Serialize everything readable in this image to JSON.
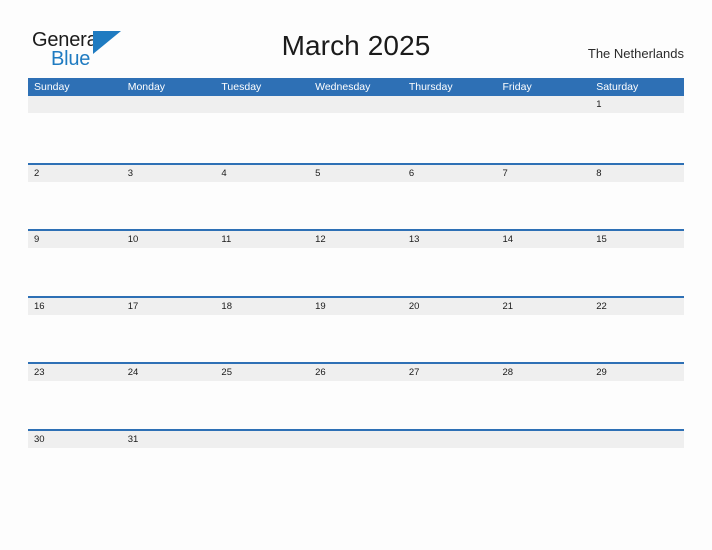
{
  "brand": {
    "name_part1": "General",
    "name_part2": "Blue",
    "triangle_color": "#1f7bc1"
  },
  "header": {
    "title": "March 2025",
    "subtitle": "The Netherlands"
  },
  "theme": {
    "header_blue": "#2e70b5",
    "date_band_gray": "#efefef",
    "page_background": "#fdfdfd",
    "text_dark": "#1b1b1b",
    "logo_blue": "#1f7bc1"
  },
  "calendar": {
    "weekdays": [
      "Sunday",
      "Monday",
      "Tuesday",
      "Wednesday",
      "Thursday",
      "Friday",
      "Saturday"
    ],
    "weeks": [
      [
        "",
        "",
        "",
        "",
        "",
        "",
        "1"
      ],
      [
        "2",
        "3",
        "4",
        "5",
        "6",
        "7",
        "8"
      ],
      [
        "9",
        "10",
        "11",
        "12",
        "13",
        "14",
        "15"
      ],
      [
        "16",
        "17",
        "18",
        "19",
        "20",
        "21",
        "22"
      ],
      [
        "23",
        "24",
        "25",
        "26",
        "27",
        "28",
        "29"
      ],
      [
        "30",
        "31",
        "",
        "",
        "",
        "",
        ""
      ]
    ]
  }
}
